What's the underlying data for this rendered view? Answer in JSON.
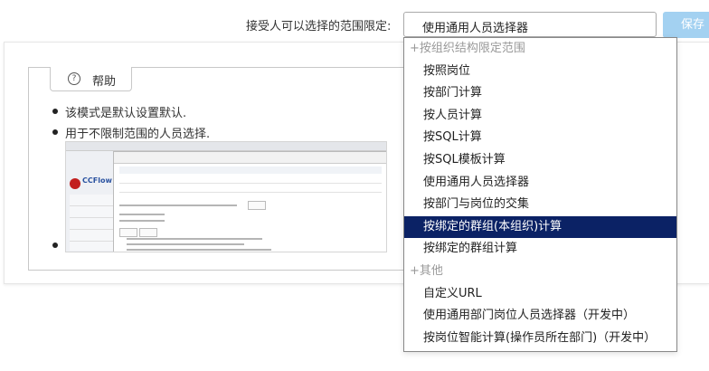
{
  "form": {
    "range_label": "接受人可以选择的范围限定:",
    "select_value": "使用通用人员选择器",
    "save_label": "保存"
  },
  "help": {
    "tab_label": "帮助",
    "bullets": [
      "该模式是默认设置默认.",
      "用于不限制范围的人员选择."
    ],
    "thumbnail_logo": "CCFlow"
  },
  "dropdown": {
    "items": [
      {
        "type": "group",
        "label": "+按组织结构限定范围"
      },
      {
        "type": "option",
        "label": "按照岗位"
      },
      {
        "type": "option",
        "label": "按部门计算"
      },
      {
        "type": "option",
        "label": "按人员计算"
      },
      {
        "type": "option",
        "label": "按SQL计算"
      },
      {
        "type": "option",
        "label": "按SQL模板计算"
      },
      {
        "type": "option",
        "label": "使用通用人员选择器"
      },
      {
        "type": "option",
        "label": "按部门与岗位的交集"
      },
      {
        "type": "option",
        "label": "按绑定的群组(本组织)计算",
        "selected": true
      },
      {
        "type": "option",
        "label": "按绑定的群组计算"
      },
      {
        "type": "group",
        "label": "+其他"
      },
      {
        "type": "option",
        "label": "自定义URL"
      },
      {
        "type": "option",
        "label": "使用通用部门岗位人员选择器（开发中）"
      },
      {
        "type": "option",
        "label": "按岗位智能计算(操作员所在部门)（开发中）"
      }
    ]
  },
  "colors": {
    "save_button_bg": "#a3d1f1",
    "selected_option_bg": "#0b2265"
  }
}
